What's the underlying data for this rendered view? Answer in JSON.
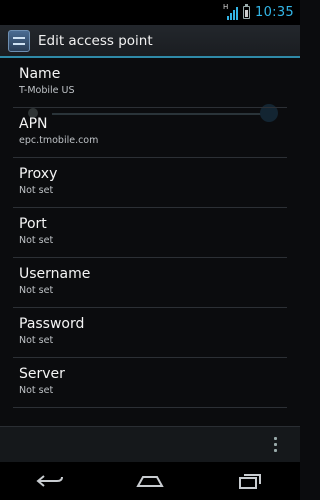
{
  "status_bar": {
    "network_type": "H",
    "time": "10:35",
    "accent_color": "#33b5e5"
  },
  "action_bar": {
    "title": "Edit access point",
    "icon": "settings-app-icon"
  },
  "fields": [
    {
      "label": "Name",
      "value": "T-Mobile US"
    },
    {
      "label": "APN",
      "value": "epc.tmobile.com"
    },
    {
      "label": "Proxy",
      "value": "Not set"
    },
    {
      "label": "Port",
      "value": "Not set"
    },
    {
      "label": "Username",
      "value": "Not set"
    },
    {
      "label": "Password",
      "value": "Not set"
    },
    {
      "label": "Server",
      "value": "Not set"
    }
  ],
  "bottom_bar": {
    "menu_icon": "overflow-menu-icon"
  },
  "nav_bar": {
    "buttons": [
      "back-icon",
      "home-icon",
      "recents-icon"
    ]
  }
}
